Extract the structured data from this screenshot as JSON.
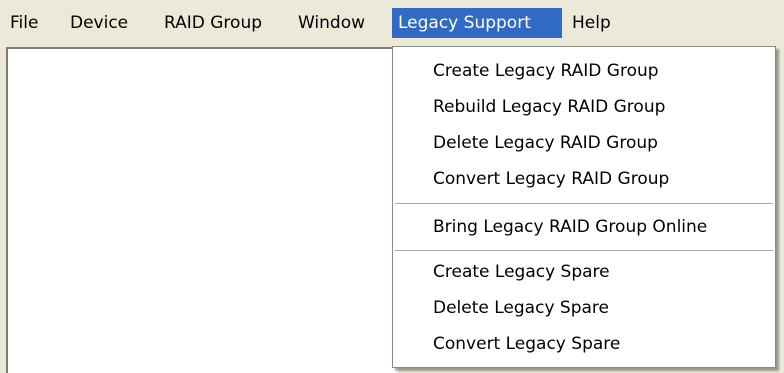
{
  "menubar": {
    "items": [
      "File",
      "Device",
      "RAID Group",
      "Window",
      "Legacy Support",
      "Help"
    ],
    "active_index": 4
  },
  "legacy_menu": {
    "groups": [
      [
        "Create Legacy RAID Group",
        "Rebuild Legacy RAID Group",
        "Delete Legacy RAID Group",
        "Convert Legacy RAID Group"
      ],
      [
        "Bring Legacy RAID Group Online"
      ],
      [
        "Create Legacy Spare",
        "Delete Legacy Spare",
        "Convert Legacy Spare"
      ]
    ]
  },
  "colors": {
    "highlight": "#316ac5",
    "menubar_bg": "#ece9d8",
    "menu_bg": "#ffffff"
  }
}
